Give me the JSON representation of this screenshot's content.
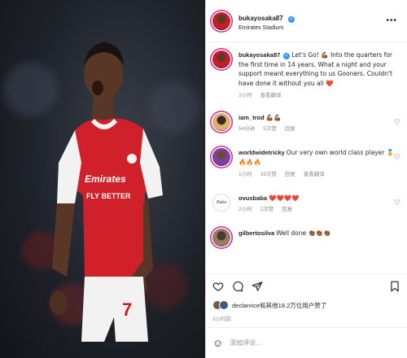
{
  "post": {
    "username": "bukayosaka87",
    "location": "Emirates Stadium",
    "more_label": "•••"
  },
  "caption": {
    "username": "bukayosaka87",
    "text": "Let's Go! 💪🏾 Into the quarters for the first time in 14 years. What a night and your support meant everything to us Gooners. Couldn't have done it without you all ❤️",
    "time": "2小时",
    "translate": "查看翻译"
  },
  "comments": [
    {
      "username": "iam_trod",
      "text": "💪🏾💪🏾",
      "time": "54分钟",
      "likes": "5次赞",
      "reply": "回复",
      "translate": ""
    },
    {
      "username": "worldwidetricky",
      "text": "Our very own world class player 🏅🔥🔥🔥",
      "time": "1小时",
      "likes": "18次赞",
      "reply": "回复",
      "translate": "查看翻译"
    },
    {
      "username": "ovusbaba",
      "text": "❤️❤️❤️❤️",
      "time": "2小时",
      "likes": "2次赞",
      "reply": "回复",
      "translate": ""
    },
    {
      "username": "gilbertosilva",
      "text": "Well done 👏🏾👏🏾👏🏾",
      "time": "",
      "likes": "",
      "reply": "",
      "translate": ""
    }
  ],
  "likes": {
    "text": "declanrice和其他18.2万位用户赞了"
  },
  "time_ago": "2小时前",
  "add_comment": {
    "placeholder": "添加评论…"
  },
  "icons": [
    "heart-icon",
    "comment-icon",
    "share-icon",
    "bookmark-icon",
    "smile-icon",
    "verified-icon"
  ]
}
